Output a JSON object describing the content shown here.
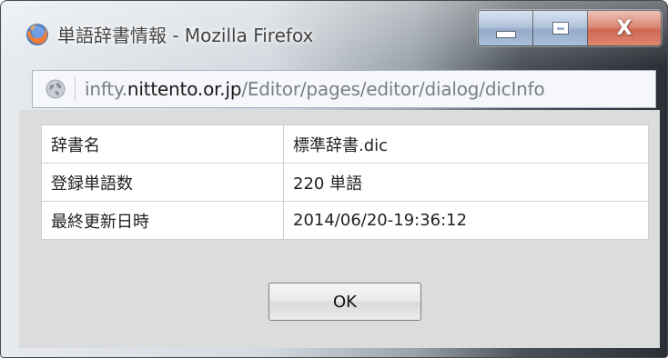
{
  "window": {
    "title": "単語辞書情報 - Mozilla Firefox",
    "icon": "firefox-icon",
    "controls": {
      "minimize": "minimize-icon",
      "maximize": "maximize-icon",
      "close_glyph": "X"
    }
  },
  "urlbar": {
    "icon": "globe-icon",
    "prefix": "infty.",
    "domain": "nittento.or.jp",
    "path": "/Editor/pages/editor/dialog/dicInfo"
  },
  "info": {
    "rows": [
      {
        "label": "辞書名",
        "value": "標準辞書.dic"
      },
      {
        "label": "登録単語数",
        "value": "220 単語"
      },
      {
        "label": "最終更新日時",
        "value": "2014/06/20-19:36:12"
      }
    ]
  },
  "ok_button": "OK",
  "colors": {
    "close_button": "#c2432a",
    "caption_button": "#9cb4d2",
    "content_background": "#dcdcdc"
  }
}
